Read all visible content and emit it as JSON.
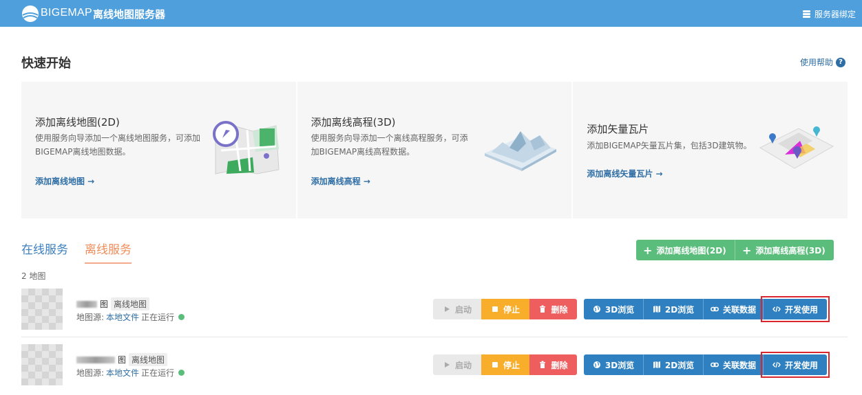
{
  "header": {
    "brand": "BIGEMAP",
    "title": "离线地图服务器",
    "bind_label": "服务器绑定"
  },
  "quick_start": {
    "title": "快速开始",
    "help_label": "使用帮助",
    "help_icon": "?",
    "cards": [
      {
        "title": "添加离线地图(2D)",
        "desc": "使用服务向导添加一个离线地图服务，可添加BIGEMAP离线地图数据。",
        "link": "添加离线地图 →"
      },
      {
        "title": "添加离线高程(3D)",
        "desc": "使用服务向导添加一个离线高程服务，可添加BIGEMAP离线高程数据。",
        "link": "添加离线高程 →"
      },
      {
        "title": "添加矢量瓦片",
        "desc": "添加BIGEMAP矢量瓦片集，包括3D建筑物。",
        "link": "添加离线矢量瓦片 →"
      }
    ]
  },
  "tabs": {
    "online": "在线服务",
    "offline": "离线服务"
  },
  "actions": {
    "add_2d": "添加离线地图(2D)",
    "add_3d": "添加离线高程(3D)",
    "plus": "+"
  },
  "list": {
    "count_label": "2 地图",
    "rows": [
      {
        "name_visible": "图",
        "tag": "离线地图",
        "source_label": "地图源:",
        "source_value": "本地文件",
        "status": "正在运行"
      },
      {
        "name_visible": "图",
        "tag": "离线地图",
        "source_label": "地图源:",
        "source_value": "本地文件",
        "status": "正在运行"
      }
    ],
    "buttons": {
      "start": "启动",
      "stop": "停止",
      "delete": "删除",
      "view3d": "3D浏览",
      "view2d": "2D浏览",
      "link_data": "关联数据",
      "dev_use": "开发使用"
    }
  },
  "colors": {
    "header": "#4f9fdc",
    "green": "#5bbd7c",
    "orange": "#f9ae2b",
    "red": "#ee5e5e",
    "blue": "#2f80c0",
    "highlight": "#d9262c"
  }
}
